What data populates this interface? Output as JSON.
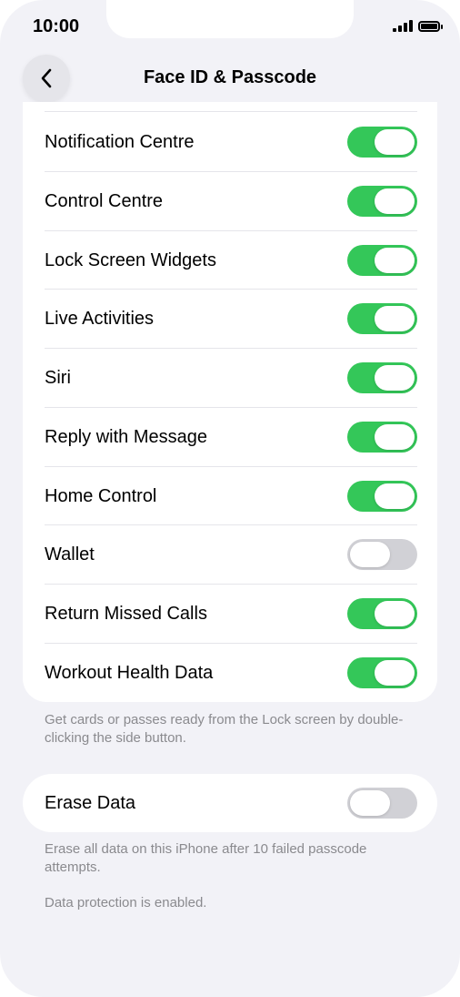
{
  "status": {
    "time": "10:00"
  },
  "nav": {
    "title": "Face ID & Passcode",
    "back_icon": "chevron-left-icon"
  },
  "allow_access": {
    "items": [
      {
        "label": "Notification Centre",
        "enabled": true
      },
      {
        "label": "Control Centre",
        "enabled": true
      },
      {
        "label": "Lock Screen Widgets",
        "enabled": true
      },
      {
        "label": "Live Activities",
        "enabled": true
      },
      {
        "label": "Siri",
        "enabled": true
      },
      {
        "label": "Reply with Message",
        "enabled": true
      },
      {
        "label": "Home Control",
        "enabled": true
      },
      {
        "label": "Wallet",
        "enabled": false
      },
      {
        "label": "Return Missed Calls",
        "enabled": true
      },
      {
        "label": "Workout Health Data",
        "enabled": true
      }
    ],
    "footer": "Get cards or passes ready from the Lock screen by double-clicking the side button."
  },
  "erase": {
    "label": "Erase Data",
    "enabled": false,
    "footer": "Erase all data on this iPhone after 10 failed passcode attempts.",
    "protection_note": "Data protection is enabled."
  },
  "colors": {
    "toggle_on": "#34c759",
    "toggle_off": "#d1d1d6",
    "background": "#f2f2f7"
  }
}
